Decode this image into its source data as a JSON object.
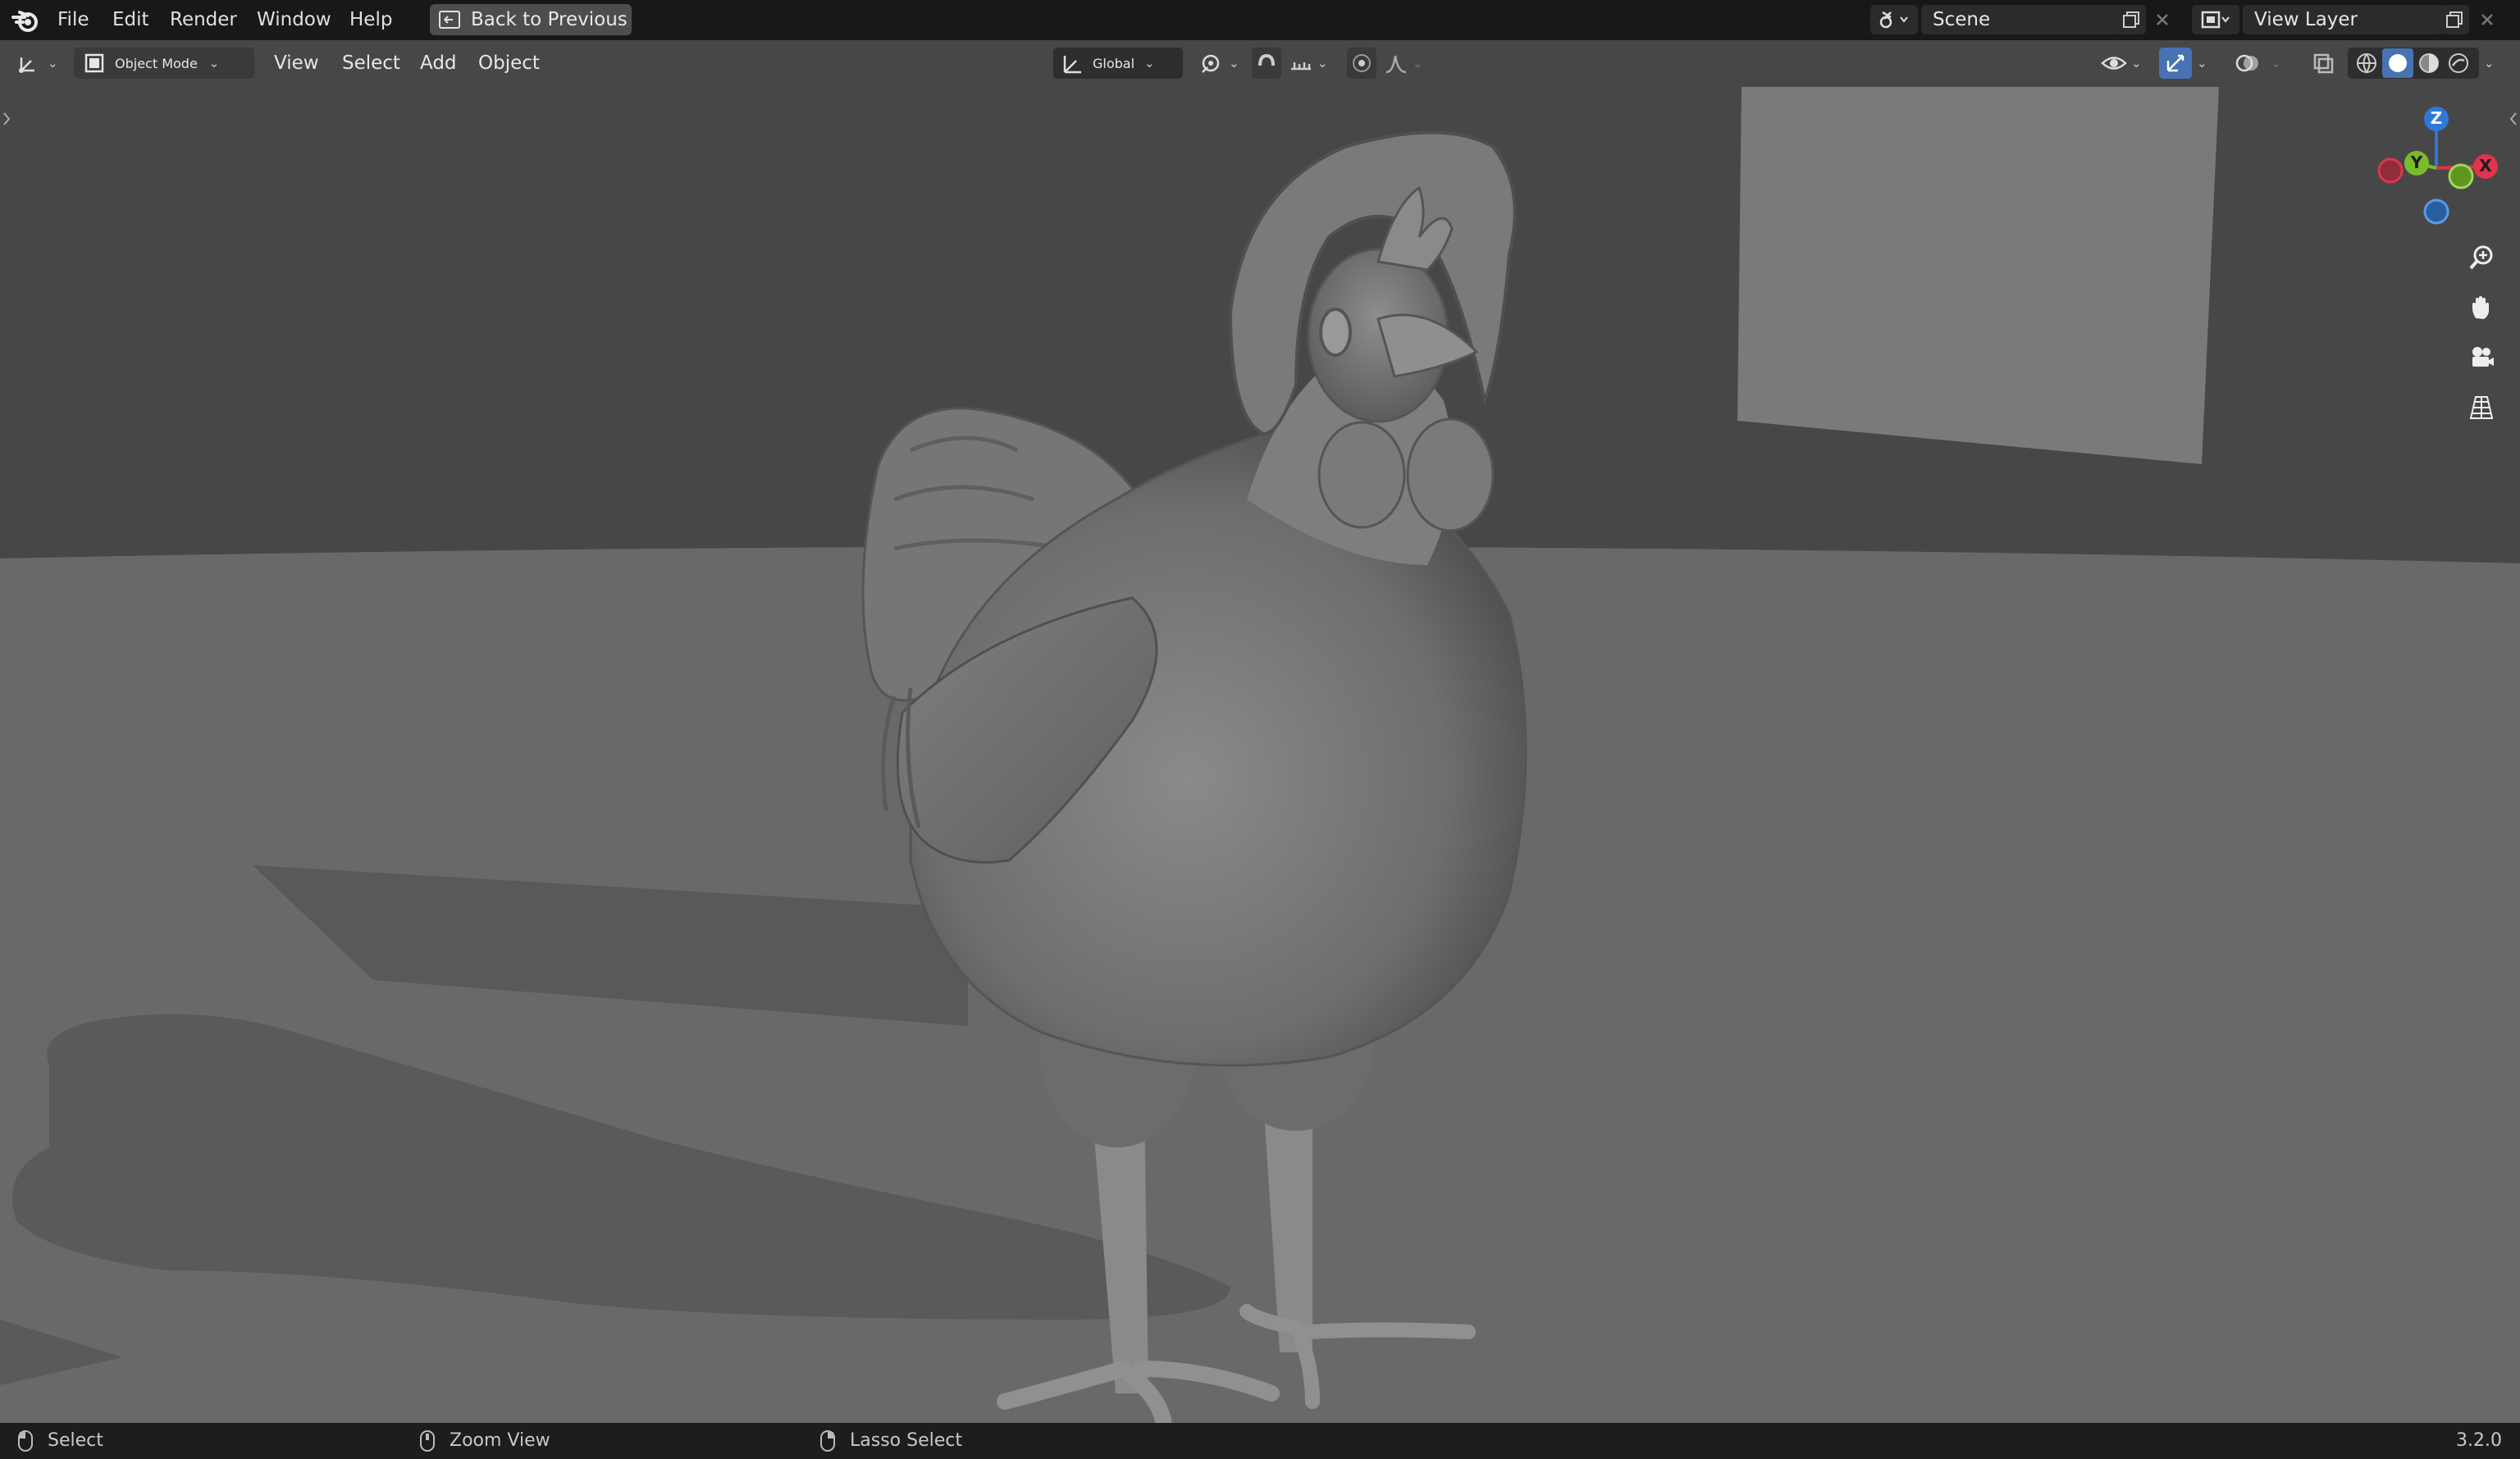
{
  "menu": {
    "file": "File",
    "edit": "Edit",
    "render": "Render",
    "window": "Window",
    "help": "Help",
    "back_to_previous": "Back to Previous"
  },
  "scene_selector": {
    "value": "Scene"
  },
  "view_layer_selector": {
    "value": "View Layer"
  },
  "viewport_header": {
    "mode": "Object Mode",
    "view": "View",
    "select": "Select",
    "add": "Add",
    "object": "Object",
    "transform_orientation": "Global"
  },
  "gizmo": {
    "z": "Z",
    "y": "Y",
    "x": "X"
  },
  "status": {
    "select": "Select",
    "zoom_view": "Zoom View",
    "lasso_select": "Lasso Select",
    "version": "3.2.0"
  },
  "icons": {
    "logo": "blender-logo-icon",
    "back": "back-to-previous-icon",
    "scene": "scene-icon",
    "view_layer": "view-layer-icon",
    "zoom": "zoom-icon",
    "pan": "hand-icon",
    "camera": "camera-icon",
    "perspective": "grid-perspective-icon"
  },
  "colors": {
    "topbar": "#181818",
    "viewport_floor": "#696969",
    "viewport_wall": "#474747",
    "axis_x": "#e0344c",
    "axis_y": "#7bbb2a",
    "axis_z": "#2f78d6",
    "active_toggle": "#4772b3"
  }
}
